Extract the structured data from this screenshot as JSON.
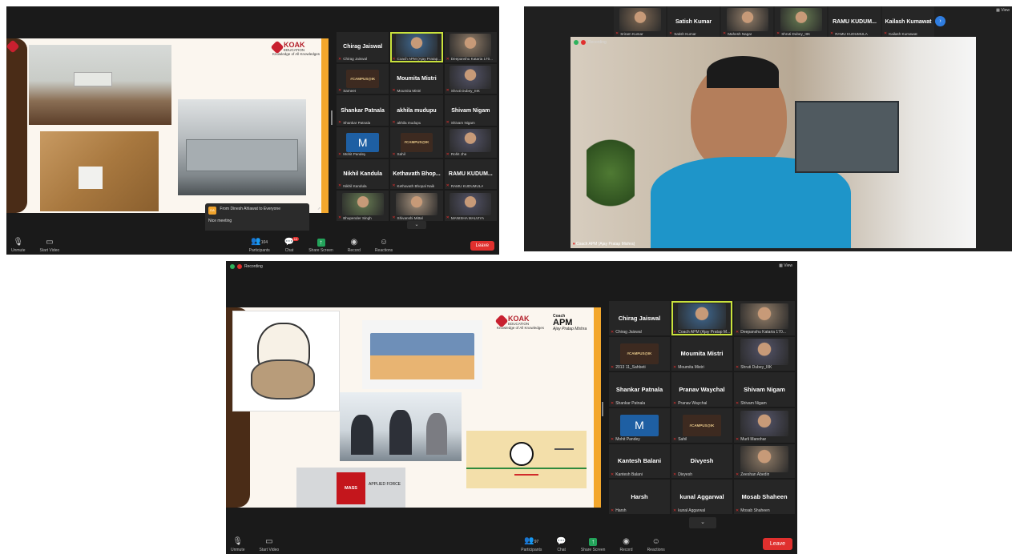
{
  "toolbar": {
    "unmute": "Unmute",
    "start_video": "Start Video",
    "participants": "Participants",
    "participants_count_1": "104",
    "participants_count_3": "97",
    "chat": "Chat",
    "chat_badge": "10",
    "share_screen": "Share Screen",
    "record": "Record",
    "reactions": "Reactions",
    "leave": "Leave"
  },
  "shot1": {
    "toast": {
      "initials": "DA",
      "title": "From Dinesh Ahlawat to Everyone",
      "message": "Nice meeting"
    },
    "logo": {
      "word": "KOAK",
      "sub_word": "EDUCATION",
      "tagline": "Knowledge of All Knowledges"
    },
    "gallery": [
      {
        "name": "Chirag Jaiswal",
        "label": "Chirag Jaiswal",
        "kind": "name"
      },
      {
        "name": "",
        "label": "Coach APM (Ajay Pratap...",
        "kind": "video",
        "active": true
      },
      {
        "name": "",
        "label": "Deepanshu Kataria 170...",
        "kind": "video"
      },
      {
        "name": "#CAMPUS@IK",
        "label": "Sameet",
        "kind": "campus"
      },
      {
        "name": "Moumita Mistri",
        "label": "Moumita Mistri",
        "kind": "name"
      },
      {
        "name": "",
        "label": "Shruti Dubey_IIIK",
        "kind": "video"
      },
      {
        "name": "Shankar Patnala",
        "label": "Shankar Patnala",
        "kind": "name"
      },
      {
        "name": "akhila mudupu",
        "label": "akhila mudupu",
        "kind": "name"
      },
      {
        "name": "Shivam Nigam",
        "label": "Shivam Nigam",
        "kind": "name"
      },
      {
        "name": "M",
        "label": "Mohit Pandey",
        "kind": "letter"
      },
      {
        "name": "#CAMPUS@IK",
        "label": "Sahil",
        "kind": "campus"
      },
      {
        "name": "",
        "label": "Rohit Jha",
        "kind": "video"
      },
      {
        "name": "Nikhil Kandula",
        "label": "Nikhil Kandula",
        "kind": "name"
      },
      {
        "name": "Kethavath Bhop...",
        "label": "Kethavath Bhopal Naik",
        "kind": "name"
      },
      {
        "name": "RAMU KUDUM...",
        "label": "RAMU KUDUMULA",
        "kind": "name"
      },
      {
        "name": "",
        "label": "Bhupender Singh",
        "kind": "video"
      },
      {
        "name": "",
        "label": "Shivanshi Mittal",
        "kind": "video"
      },
      {
        "name": "",
        "label": "MANISHA MALVIYA",
        "kind": "video"
      }
    ]
  },
  "shot2": {
    "strip": [
      {
        "name": "",
        "label": "Sriram Kumar",
        "kind": "video"
      },
      {
        "name": "Satish Kumar",
        "label": "Satish Kumar",
        "kind": "name"
      },
      {
        "name": "",
        "label": "Mahesh Nagar",
        "kind": "video"
      },
      {
        "name": "",
        "label": "Shruti Dubey_IIIK",
        "kind": "video"
      },
      {
        "name": "RAMU KUDUM...",
        "label": "RAMU KUDUMULA",
        "kind": "name"
      },
      {
        "name": "Kailash Kumawat",
        "label": "Kailash Kumawat",
        "kind": "name"
      }
    ],
    "recording": "Recording",
    "speaker_label": "Coach APM (Ajay Pratap Mishra)",
    "view": "View"
  },
  "shot3": {
    "recording": "Recording",
    "view": "View",
    "logo": {
      "word": "KOAK",
      "sub_word": "EDUCATION",
      "tagline": "Knowledge of All Knowledges"
    },
    "coach_logo": {
      "top": "Coach",
      "main": "APM",
      "sig": "Ajay Pratap Mishra"
    },
    "mass_box": {
      "mass": "MASS",
      "force": "APPLIED FORCE"
    },
    "gallery": [
      {
        "name": "Chirag Jaiswal",
        "label": "Chirag Jaiswal",
        "kind": "name"
      },
      {
        "name": "",
        "label": "Coach APM (Ajay Pratap M...",
        "kind": "video",
        "active": true
      },
      {
        "name": "",
        "label": "Deepanshu Kataria 170...",
        "kind": "video"
      },
      {
        "name": "#CAMPUS@IK",
        "label": "2013 11_Sahbeti",
        "kind": "campus"
      },
      {
        "name": "Moumita Mistri",
        "label": "Moumita Mistri",
        "kind": "name"
      },
      {
        "name": "",
        "label": "Shruti Dubey_IIIK",
        "kind": "video"
      },
      {
        "name": "Shankar Patnala",
        "label": "Shankar Patnala",
        "kind": "name"
      },
      {
        "name": "Pranav Waychal",
        "label": "Pranav Waychal",
        "kind": "name"
      },
      {
        "name": "Shivam Nigam",
        "label": "Shivam Nigam",
        "kind": "name"
      },
      {
        "name": "M",
        "label": "Mohit Pandey",
        "kind": "letter"
      },
      {
        "name": "#CAMPUS@IK",
        "label": "Sahil",
        "kind": "campus"
      },
      {
        "name": "",
        "label": "Murli Manohar",
        "kind": "video"
      },
      {
        "name": "Kantesh Balani",
        "label": "Kantesh Balani",
        "kind": "name"
      },
      {
        "name": "Divyesh",
        "label": "Divyesh",
        "kind": "name"
      },
      {
        "name": "",
        "label": "Zeeshan Abedin",
        "kind": "video"
      },
      {
        "name": "Harsh",
        "label": "Harsh",
        "kind": "name"
      },
      {
        "name": "kunal Aggarwal",
        "label": "kunal Aggarwal",
        "kind": "name"
      },
      {
        "name": "Mosab Shaheen",
        "label": "Mosab Shaheen",
        "kind": "name"
      }
    ]
  },
  "colors": {
    "accent_orange": "#f3a72c",
    "leave_red": "#e0302e",
    "active_green": "#c9e23c",
    "tile_bg": "#262626"
  }
}
